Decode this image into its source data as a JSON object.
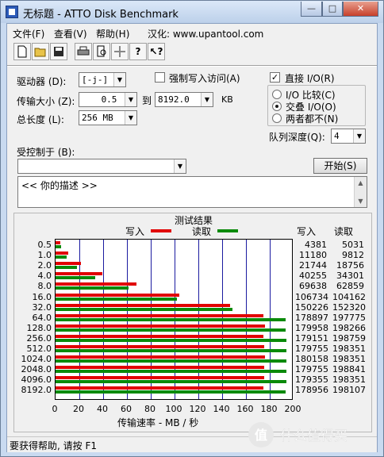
{
  "window": {
    "title": "无标题 - ATTO Disk Benchmark",
    "min": "—",
    "max": "□",
    "close": "✕"
  },
  "menu": {
    "file": "文件(F)",
    "view": "查看(V)",
    "help": "帮助(H)",
    "site": "汉化: www.upantool.com"
  },
  "toolbar": [
    "new-icon",
    "open-icon",
    "save-icon",
    "print-icon",
    "print-preview-icon",
    "move-icon",
    "help-icon",
    "context-help-icon"
  ],
  "settings": {
    "drive_label": "驱动器 (D):",
    "drive_value": "[-j-]",
    "force_write_label": "强制写入访问(A)",
    "force_write_checked": false,
    "transfer_label": "传输大小 (Z):",
    "transfer_from": "0.5",
    "to_label": "到",
    "transfer_to": "8192.0",
    "kb_label": "KB",
    "total_label": "总长度 (L):",
    "total_value": "256 MB",
    "direct_io_label": "直接 I/O(R)",
    "direct_io_checked": true,
    "io_compare_label": "I/O 比较(C)",
    "overlap_io_label": "交叠 I/O(O)",
    "neither_label": "两者都不(N)",
    "selected_io": "overlap",
    "queue_label": "队列深度(Q):",
    "queue_value": "4",
    "controlled_label": "受控制于 (B):",
    "controlled_value": "",
    "start_button": "开始(S)",
    "description": "<<  你的描述    >>"
  },
  "results": {
    "title": "测试结果",
    "legend_write": "写入",
    "legend_read": "读取",
    "col_write": "写入",
    "col_read": "读取",
    "xaxis_title": "传输速率 - MB / 秒",
    "colors": {
      "write": "#e10000",
      "read": "#0a8a0a",
      "grid": "#1a1aa0"
    }
  },
  "chart_data": {
    "type": "bar",
    "orientation": "horizontal",
    "categories": [
      "0.5",
      "1.0",
      "2.0",
      "4.0",
      "8.0",
      "16.0",
      "32.0",
      "64.0",
      "128.0",
      "256.0",
      "512.0",
      "1024.0",
      "2048.0",
      "4096.0",
      "8192.0"
    ],
    "series": [
      {
        "name": "写入",
        "values_kb": [
          4381,
          11180,
          21744,
          40255,
          69638,
          106734,
          150226,
          178897,
          179958,
          179151,
          179755,
          180158,
          179755,
          179355,
          178956
        ]
      },
      {
        "name": "读取",
        "values_kb": [
          5031,
          9812,
          18756,
          34301,
          62859,
          104162,
          152320,
          197775,
          198266,
          198759,
          198351,
          198351,
          198841,
          198351,
          198107
        ]
      }
    ],
    "xticks": [
      "0",
      "20",
      "40",
      "60",
      "80",
      "100",
      "120",
      "140",
      "160",
      "180",
      "200"
    ],
    "xlim": [
      0,
      200
    ],
    "xlabel": "传输速率 - MB / 秒",
    "grid": true
  },
  "status": {
    "text": "要获得帮助, 请按 F1"
  },
  "watermark": "值 什么值得买"
}
